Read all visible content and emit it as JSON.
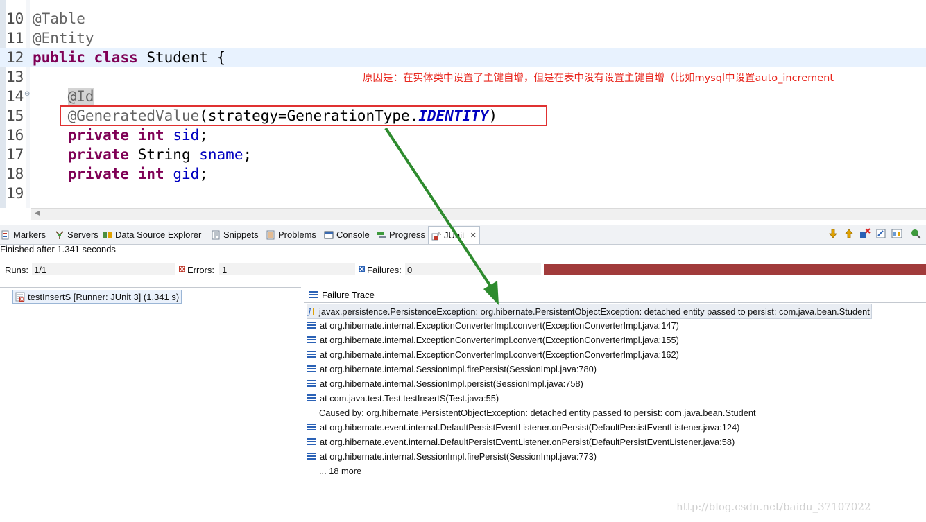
{
  "editor": {
    "lines": [
      {
        "num": "10",
        "parts": [
          {
            "t": "@Table",
            "c": "ann"
          }
        ]
      },
      {
        "num": "11",
        "parts": [
          {
            "t": "@Entity",
            "c": "ann"
          }
        ]
      },
      {
        "num": "12",
        "highlight": true,
        "parts": [
          {
            "t": "public",
            "c": "kw"
          },
          {
            "t": " "
          },
          {
            "t": "class",
            "c": "kw"
          },
          {
            "t": " Student {"
          }
        ]
      },
      {
        "num": "13",
        "parts": []
      },
      {
        "num": "14",
        "fold": true,
        "parts": [
          {
            "t": "    "
          },
          {
            "t": "@Id",
            "c": "ann id-hl"
          }
        ]
      },
      {
        "num": "15",
        "parts": [
          {
            "t": "    "
          },
          {
            "t": "@GeneratedValue",
            "c": "ann"
          },
          {
            "t": "(strategy=GenerationType."
          },
          {
            "t": "IDENTITY",
            "c": "cst"
          },
          {
            "t": ")"
          }
        ]
      },
      {
        "num": "16",
        "parts": [
          {
            "t": "    "
          },
          {
            "t": "private",
            "c": "kw"
          },
          {
            "t": " "
          },
          {
            "t": "int",
            "c": "kw"
          },
          {
            "t": " "
          },
          {
            "t": "sid",
            "c": "fld"
          },
          {
            "t": ";"
          }
        ]
      },
      {
        "num": "17",
        "parts": [
          {
            "t": "    "
          },
          {
            "t": "private",
            "c": "kw"
          },
          {
            "t": " String "
          },
          {
            "t": "sname",
            "c": "fld"
          },
          {
            "t": ";"
          }
        ]
      },
      {
        "num": "18",
        "parts": [
          {
            "t": "    "
          },
          {
            "t": "private",
            "c": "kw"
          },
          {
            "t": " "
          },
          {
            "t": "int",
            "c": "kw"
          },
          {
            "t": " "
          },
          {
            "t": "gid",
            "c": "fld"
          },
          {
            "t": ";"
          }
        ]
      },
      {
        "num": "19",
        "parts": []
      }
    ],
    "annotation_note": "原因是：在实体类中设置了主键自增，但是在表中没有设置主键自增（比如mysql中设置auto_increment"
  },
  "tabs": [
    {
      "label": "Markers",
      "icon": "markers-icon"
    },
    {
      "label": "Servers",
      "icon": "servers-icon"
    },
    {
      "label": "Data Source Explorer",
      "icon": "data-source-icon"
    },
    {
      "label": "Snippets",
      "icon": "snippets-icon"
    },
    {
      "label": "Problems",
      "icon": "problems-icon"
    },
    {
      "label": "Console",
      "icon": "console-icon"
    },
    {
      "label": "Progress",
      "icon": "progress-icon"
    },
    {
      "label": "JUnit",
      "icon": "junit-icon",
      "active": true
    }
  ],
  "junit": {
    "finished": "Finished after 1.341 seconds",
    "runs_label": "Runs:",
    "runs_value": "1/1",
    "errors_label": "Errors:",
    "errors_value": "1",
    "failures_label": "Failures:",
    "failures_value": "0",
    "progress_fraction": 1.0,
    "progress_color": "#a13b3b",
    "test_item": "testInsertS [Runner: JUnit 3] (1.341 s)",
    "trace_title": "Failure Trace",
    "trace": [
      {
        "text": "javax.persistence.PersistenceException: org.hibernate.PersistentObjectException: detached entity passed to persist: com.java.bean.Student",
        "icon": "exception-icon",
        "selected": true
      },
      {
        "text": "at org.hibernate.internal.ExceptionConverterImpl.convert(ExceptionConverterImpl.java:147)",
        "icon": "stack-icon"
      },
      {
        "text": "at org.hibernate.internal.ExceptionConverterImpl.convert(ExceptionConverterImpl.java:155)",
        "icon": "stack-icon"
      },
      {
        "text": "at org.hibernate.internal.ExceptionConverterImpl.convert(ExceptionConverterImpl.java:162)",
        "icon": "stack-icon"
      },
      {
        "text": "at org.hibernate.internal.SessionImpl.firePersist(SessionImpl.java:780)",
        "icon": "stack-icon"
      },
      {
        "text": "at org.hibernate.internal.SessionImpl.persist(SessionImpl.java:758)",
        "icon": "stack-icon"
      },
      {
        "text": "at com.java.test.Test.testInsertS(Test.java:55)",
        "icon": "stack-icon"
      },
      {
        "text": "Caused by: org.hibernate.PersistentObjectException: detached entity passed to persist: com.java.bean.Student",
        "icon": "none"
      },
      {
        "text": "at org.hibernate.event.internal.DefaultPersistEventListener.onPersist(DefaultPersistEventListener.java:124)",
        "icon": "stack-icon"
      },
      {
        "text": "at org.hibernate.event.internal.DefaultPersistEventListener.onPersist(DefaultPersistEventListener.java:58)",
        "icon": "stack-icon"
      },
      {
        "text": "at org.hibernate.internal.SessionImpl.firePersist(SessionImpl.java:773)",
        "icon": "stack-icon"
      },
      {
        "text": "... 18 more",
        "icon": "none"
      }
    ]
  },
  "watermark": "http://blog.csdn.net/baidu_37107022",
  "colors": {
    "annotation_red": "#e8241b",
    "arrow_green": "#2e8b2e",
    "keyword": "#7f0055",
    "field": "#0000c0"
  }
}
